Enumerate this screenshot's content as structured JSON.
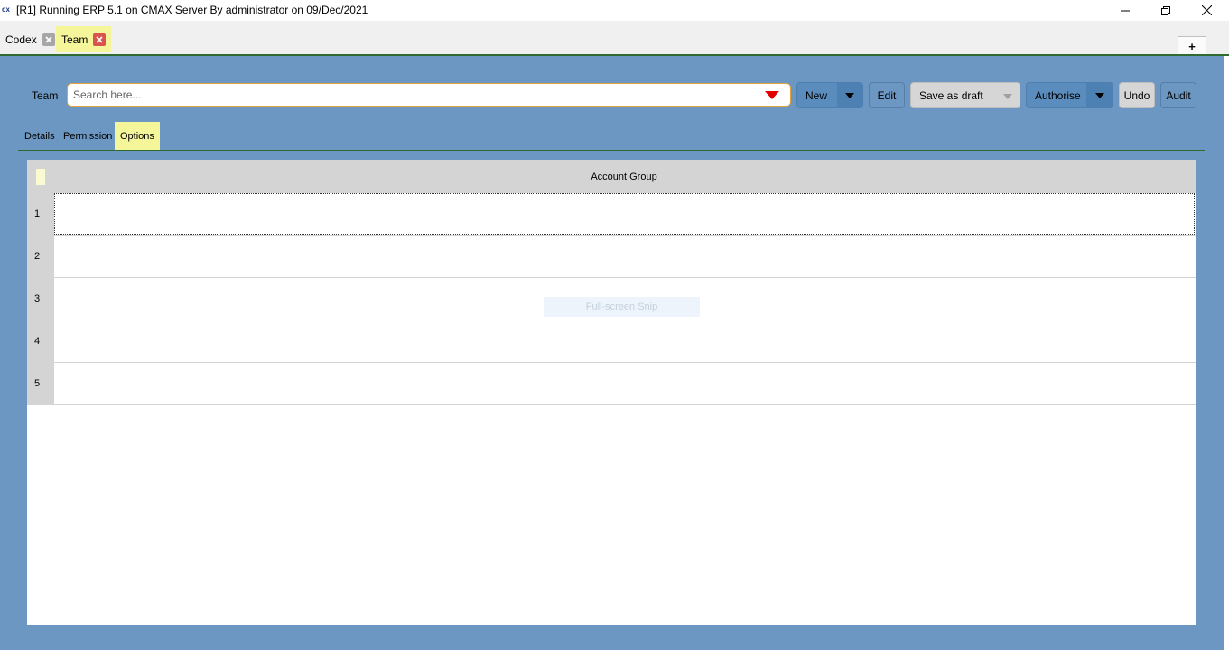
{
  "window": {
    "icon_text": "cx",
    "title": "[R1] Running ERP 5.1 on CMAX Server By administrator on 09/Dec/2021"
  },
  "doc_tabs": [
    {
      "label": "Codex",
      "active": false
    },
    {
      "label": "Team",
      "active": true
    }
  ],
  "add_tab_label": "+",
  "toolbar": {
    "field_label": "Team",
    "search_placeholder": "Search here...",
    "new_label": "New",
    "edit_label": "Edit",
    "save_draft_label": "Save as draft",
    "authorise_label": "Authorise",
    "undo_label": "Undo",
    "audit_label": "Audit"
  },
  "sub_tabs": [
    {
      "label": "Details",
      "active": false
    },
    {
      "label": "Permission",
      "active": false
    },
    {
      "label": "Options",
      "active": true
    }
  ],
  "grid": {
    "column_header": "Account Group",
    "rows": [
      "1",
      "2",
      "3",
      "4",
      "5"
    ]
  },
  "overlay": {
    "text": "Full-screen Snip"
  },
  "colors": {
    "panel": "#6b97c2",
    "active_tab": "#f5f59a",
    "accent_green": "#2e6b2e",
    "search_caret": "#e00000"
  }
}
